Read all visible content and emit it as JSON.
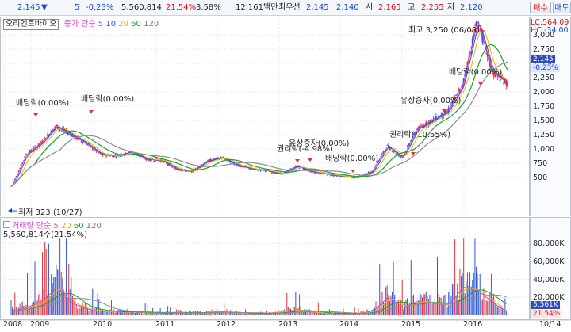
{
  "header": {
    "price": "2,145",
    "change_arrow": "▼",
    "change": "5",
    "change_pct": "-0.23%",
    "volume": "5,560,814",
    "turnover_ratio": "21.54%",
    "pct2": "3.58%",
    "amount": "12,161백만",
    "priority_label": "최우선",
    "ask1": "2,145",
    "bid1": "2,140",
    "open_label": "시",
    "open": "2,165",
    "high_label": "고",
    "high": "2,255",
    "low_label": "저",
    "low": "2,120",
    "buy_button": "매수",
    "sell_button": "매도"
  },
  "price_panel": {
    "stock_name": "오리엔트바이오",
    "ma_label": "종가 단순",
    "ma_periods": [
      "5",
      "10",
      "20",
      "60",
      "120"
    ],
    "ma_colors": [
      "#e23dd6",
      "#2a4bd8",
      "#d8c400",
      "#1a9e2a",
      "#8b8b8b"
    ],
    "lc_label": "LC:564.09",
    "hc_label": "HC:-34.00",
    "y_ticks": [
      "3,000",
      "2,750",
      "2,500",
      "2,250",
      "2,000",
      "1,750",
      "1,500",
      "1,250",
      "1,000",
      "750",
      "500"
    ],
    "current_price_tag": "2,145",
    "current_change_tag": "-0.23%",
    "max_annotation": "최고 3,250 (06/08)",
    "min_annotation": "최저 323 (10/27)",
    "events": [
      "배당락(0.00%)",
      "배당락(0.00%)",
      "권리락(-4.98%)",
      "유상증자(0.00%)",
      "배당락(0.00%)",
      "권리락(-10.55%)",
      "유상증자(0.00%)",
      "배당락(0.00%)"
    ]
  },
  "volume_panel": {
    "title": "거래량 단순",
    "ma_periods": [
      "5",
      "20",
      "60",
      "120"
    ],
    "ma_colors": [
      "#e23dd6",
      "#d8c400",
      "#1a9e2a",
      "#8b8b8b"
    ],
    "last_volume": "5,560,814주(21.54%)",
    "y_ticks": [
      "80,000K",
      "60,000K",
      "40,000K",
      "20,000K"
    ],
    "current_tag": "5,561K",
    "current_pct_tag": "21.54%"
  },
  "x_axis": [
    "2008",
    "2009",
    "2010",
    "2011",
    "2012",
    "2013",
    "2014",
    "2015",
    "2016",
    "10/14"
  ],
  "chart_data": {
    "type": "line",
    "title": "오리엔트바이오",
    "x": [
      "2008-10",
      "2009-01",
      "2009-04",
      "2009-07",
      "2009-10",
      "2010-01",
      "2010-04",
      "2010-07",
      "2010-10",
      "2011-01",
      "2011-04",
      "2011-07",
      "2011-10",
      "2012-01",
      "2012-04",
      "2012-07",
      "2012-10",
      "2013-01",
      "2013-04",
      "2013-07",
      "2013-10",
      "2014-01",
      "2014-04",
      "2014-07",
      "2014-10",
      "2015-01",
      "2015-04",
      "2015-07",
      "2015-10",
      "2016-01",
      "2016-04",
      "2016-06",
      "2016-08",
      "2016-10"
    ],
    "series": [
      {
        "name": "종가",
        "values": [
          323,
          900,
          1100,
          1400,
          1250,
          1100,
          900,
          880,
          950,
          820,
          800,
          650,
          600,
          780,
          850,
          720,
          650,
          620,
          560,
          700,
          600,
          560,
          520,
          500,
          600,
          1050,
          850,
          1350,
          1500,
          1650,
          2100,
          3250,
          2350,
          2145
        ]
      },
      {
        "name": "거래량",
        "values": [
          10000,
          20000,
          35000,
          70000,
          30000,
          15000,
          10000,
          8000,
          9000,
          6000,
          5000,
          8000,
          6000,
          7000,
          9000,
          5000,
          4000,
          5000,
          9000,
          14000,
          7000,
          5000,
          4000,
          5000,
          10000,
          45000,
          20000,
          35000,
          30000,
          25000,
          70000,
          60000,
          30000,
          5561
        ]
      }
    ],
    "ylim": [
      300,
      3300
    ]
  }
}
